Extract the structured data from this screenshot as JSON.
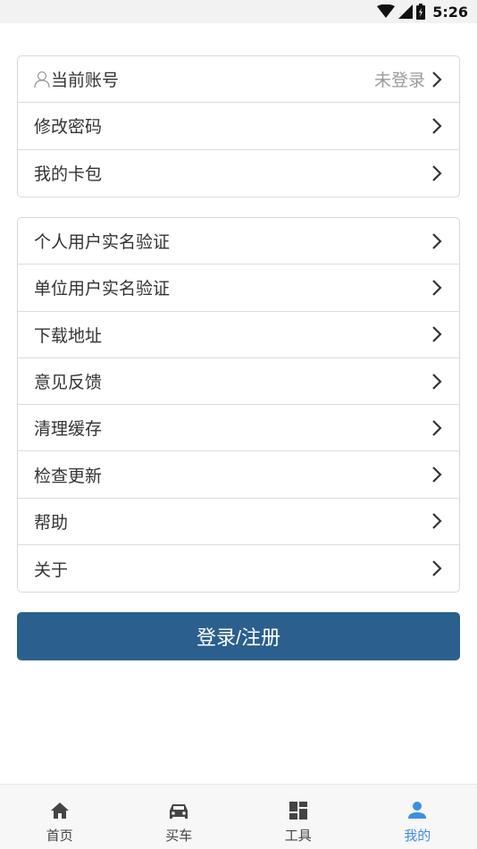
{
  "status_bar": {
    "time": "5:26"
  },
  "account_group": [
    {
      "label": "当前账号",
      "value": "未登录"
    },
    {
      "label": "修改密码"
    },
    {
      "label": "我的卡包"
    }
  ],
  "menu_group": [
    {
      "label": "个人用户实名验证"
    },
    {
      "label": "单位用户实名验证"
    },
    {
      "label": "下载地址"
    },
    {
      "label": "意见反馈"
    },
    {
      "label": "清理缓存"
    },
    {
      "label": "检查更新"
    },
    {
      "label": "帮助"
    },
    {
      "label": "关于"
    }
  ],
  "login_button": {
    "label": "登录/注册"
  },
  "tabs": [
    {
      "label": "首页",
      "icon": "home-icon"
    },
    {
      "label": "买车",
      "icon": "car-icon"
    },
    {
      "label": "工具",
      "icon": "dashboard-icon"
    },
    {
      "label": "我的",
      "icon": "person-icon",
      "active": true
    }
  ],
  "colors": {
    "accent": "#2b5f8e",
    "tab_active": "#3d8fe0"
  }
}
